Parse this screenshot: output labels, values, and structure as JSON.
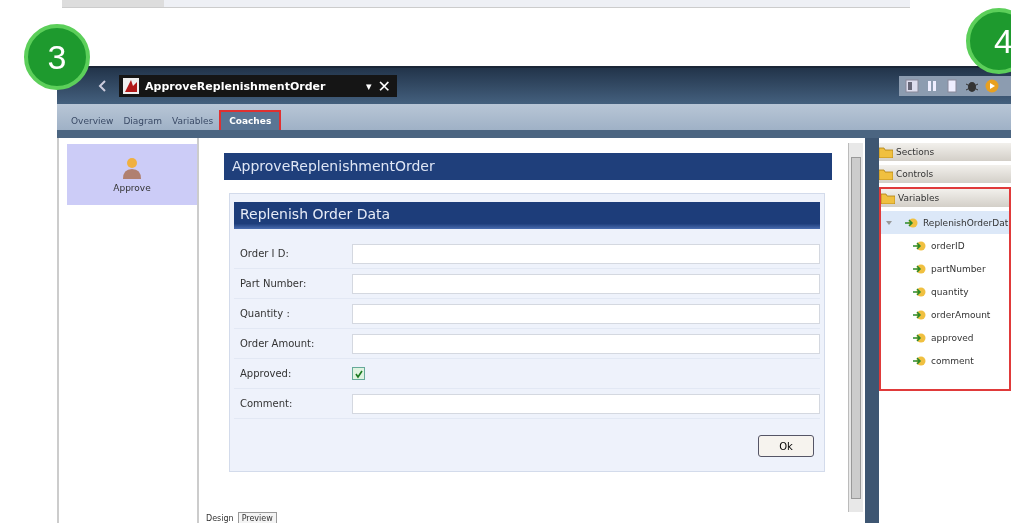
{
  "annotations": [
    {
      "label": "3"
    },
    {
      "label": "4"
    }
  ],
  "editor_tab": {
    "title": "ApproveReplenishmentOrder",
    "dropdown": "▾",
    "close": "✕"
  },
  "tabs": [
    {
      "label": "Overview",
      "selected": false,
      "highlighted": false
    },
    {
      "label": "Diagram",
      "selected": false,
      "highlighted": false
    },
    {
      "label": "Variables",
      "selected": false,
      "highlighted": false
    },
    {
      "label": "Coaches",
      "selected": true,
      "highlighted": true
    }
  ],
  "left_panel": {
    "items": [
      {
        "label": "Approve",
        "selected": true
      }
    ]
  },
  "coach": {
    "title": "ApproveReplenishmentOrder",
    "section": {
      "title": "Replenish Order Data",
      "fields": [
        {
          "kind": "text",
          "label": "Order I D:"
        },
        {
          "kind": "text",
          "label": "Part Number:"
        },
        {
          "kind": "text",
          "label": "Quantity :"
        },
        {
          "kind": "text",
          "label": "Order Amount:"
        },
        {
          "kind": "checkbox",
          "label": "Approved:",
          "checked": true
        },
        {
          "kind": "text",
          "label": "Comment:"
        }
      ],
      "button": "Ok"
    }
  },
  "bottom_tabs": [
    {
      "label": "Design",
      "selected": true
    },
    {
      "label": "Preview",
      "selected": false
    }
  ],
  "palette": {
    "sections": [
      {
        "label": "Sections"
      },
      {
        "label": "Controls"
      }
    ],
    "variables": {
      "label": "Variables",
      "highlighted": true,
      "tree": [
        {
          "label": "ReplenishOrderDat",
          "expanded": true,
          "selected": true,
          "children": [
            {
              "label": "orderID",
              "selected": false
            },
            {
              "label": "partNumber",
              "selected": false
            },
            {
              "label": "quantity",
              "selected": false
            },
            {
              "label": "orderAmount",
              "selected": false
            },
            {
              "label": "approved",
              "selected": false
            },
            {
              "label": "comment",
              "selected": false
            }
          ]
        }
      ]
    }
  }
}
